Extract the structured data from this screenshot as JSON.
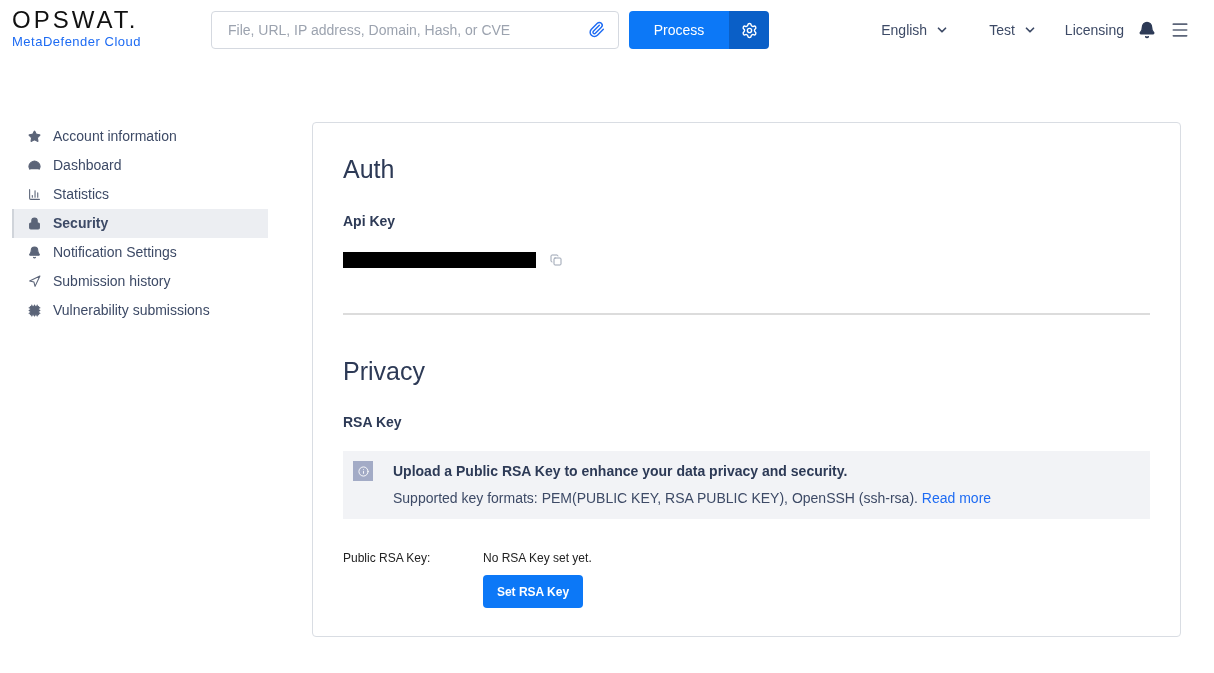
{
  "header": {
    "logo": "OPSWAT.",
    "product": "MetaDefender Cloud",
    "search": {
      "placeholder": "File, URL, IP address, Domain, Hash, or CVE"
    },
    "process_button": "Process",
    "language": "English",
    "user": "Test",
    "licensing": "Licensing"
  },
  "sidebar": {
    "items": [
      {
        "label": "Account information",
        "selected": false
      },
      {
        "label": "Dashboard",
        "selected": false
      },
      {
        "label": "Statistics",
        "selected": false
      },
      {
        "label": "Security",
        "selected": true
      },
      {
        "label": "Notification Settings",
        "selected": false
      },
      {
        "label": "Submission history",
        "selected": false
      },
      {
        "label": "Vulnerability submissions",
        "selected": false
      }
    ]
  },
  "auth": {
    "title": "Auth",
    "api_key_label": "Api Key"
  },
  "privacy": {
    "title": "Privacy",
    "rsa_label": "RSA Key",
    "notice": {
      "title": "Upload a Public RSA Key to enhance your data privacy and security.",
      "text": "Supported key formats: PEM(PUBLIC KEY, RSA PUBLIC KEY), OpenSSH (ssh-rsa).",
      "link": "Read more"
    },
    "field_label": "Public RSA Key:",
    "field_value": "No RSA Key set yet.",
    "button": "Set RSA Key"
  }
}
